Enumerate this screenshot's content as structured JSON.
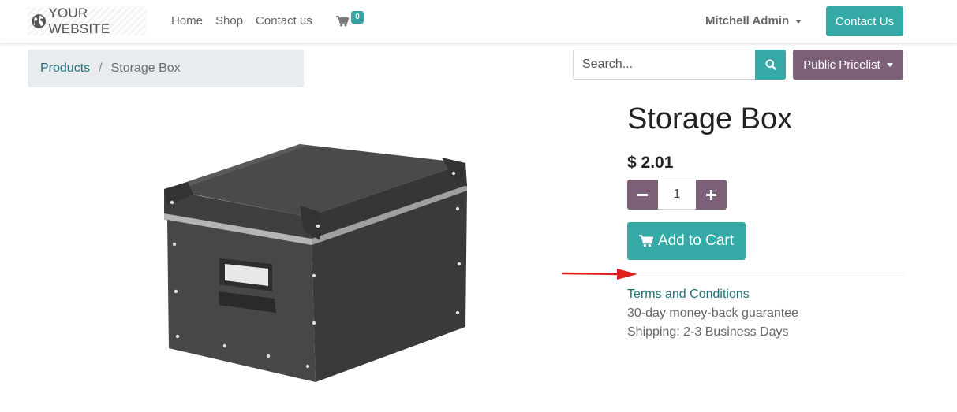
{
  "header": {
    "logo_text": "YOUR WEBSITE",
    "nav": [
      "Home",
      "Shop",
      "Contact us"
    ],
    "cart_count": "0",
    "user_name": "Mitchell Admin",
    "contact_button": "Contact Us"
  },
  "breadcrumb": {
    "parent": "Products",
    "separator": "/",
    "current": "Storage Box"
  },
  "search": {
    "placeholder": "Search..."
  },
  "pricelist": {
    "label": "Public Pricelist"
  },
  "product": {
    "name": "Storage Box",
    "price": "$ 2.01",
    "quantity": "1",
    "add_to_cart": "Add to Cart",
    "terms_link": "Terms and Conditions",
    "guarantee": "30-day money-back guarantee",
    "shipping": "Shipping: 2-3 Business Days"
  },
  "colors": {
    "accent": "#35a9a5",
    "secondary": "#7b6077",
    "link": "#1f6f79",
    "annotation_arrow": "#e0201c"
  },
  "icons": {
    "logo": "globe-icon",
    "cart": "shopping-cart-icon",
    "search": "search-icon",
    "minus": "minus-icon",
    "plus": "plus-icon",
    "add_to_cart": "shopping-cart-icon"
  }
}
